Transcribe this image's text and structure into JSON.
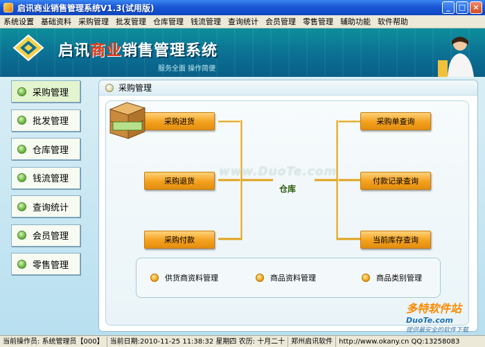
{
  "window": {
    "title": "启讯商业销售管理系统V1.3(试用版)",
    "minimize_glyph": "_",
    "maximize_glyph": "□",
    "close_glyph": "×"
  },
  "menu": [
    "系统设置",
    "基础资料",
    "采购管理",
    "批发管理",
    "仓库管理",
    "钱流管理",
    "查询统计",
    "会员管理",
    "零售管理",
    "辅助功能",
    "软件帮助"
  ],
  "banner": {
    "title_part1": "启讯",
    "title_highlight": "商业",
    "title_part2": "销售管理系统",
    "slogan": "服务全面  操作简便"
  },
  "sidebar": {
    "items": [
      {
        "label": "采购管理",
        "active": true
      },
      {
        "label": "批发管理",
        "active": false
      },
      {
        "label": "仓库管理",
        "active": false
      },
      {
        "label": "钱流管理",
        "active": false
      },
      {
        "label": "查询统计",
        "active": false
      },
      {
        "label": "会员管理",
        "active": false
      },
      {
        "label": "零售管理",
        "active": false
      }
    ]
  },
  "panel": {
    "title": "采购管理",
    "left_nodes": [
      "采购进货",
      "采购退货",
      "采购付款"
    ],
    "center_label": "仓库",
    "right_nodes": [
      "采购单查询",
      "付款记录查询",
      "当前库存查询"
    ],
    "quick_links": [
      "供货商资料管理",
      "商品资料管理",
      "商品类别管理"
    ]
  },
  "watermarks": {
    "center": "www.DuoTe.com",
    "corner_title": "多特软件站",
    "corner_sub": "DuoTe.com",
    "corner_site": "提供最安全的软件下载"
  },
  "statusbar": {
    "operator_label": "当前操作员:",
    "operator": "系统管理员【000】",
    "date_label": "当前日期:",
    "date": "2010-11-25 11:38:32 星期四 农历: 十月二十",
    "company": "郑州启讯软件",
    "website": "http://www.okany.cn QQ:13258083"
  },
  "colors": {
    "title_bar": "#1a56d6",
    "banner": "#0b6f93",
    "node_orange": "#f4a01d",
    "connector": "#e0a21a",
    "side_dot_green": "#6fb544"
  }
}
